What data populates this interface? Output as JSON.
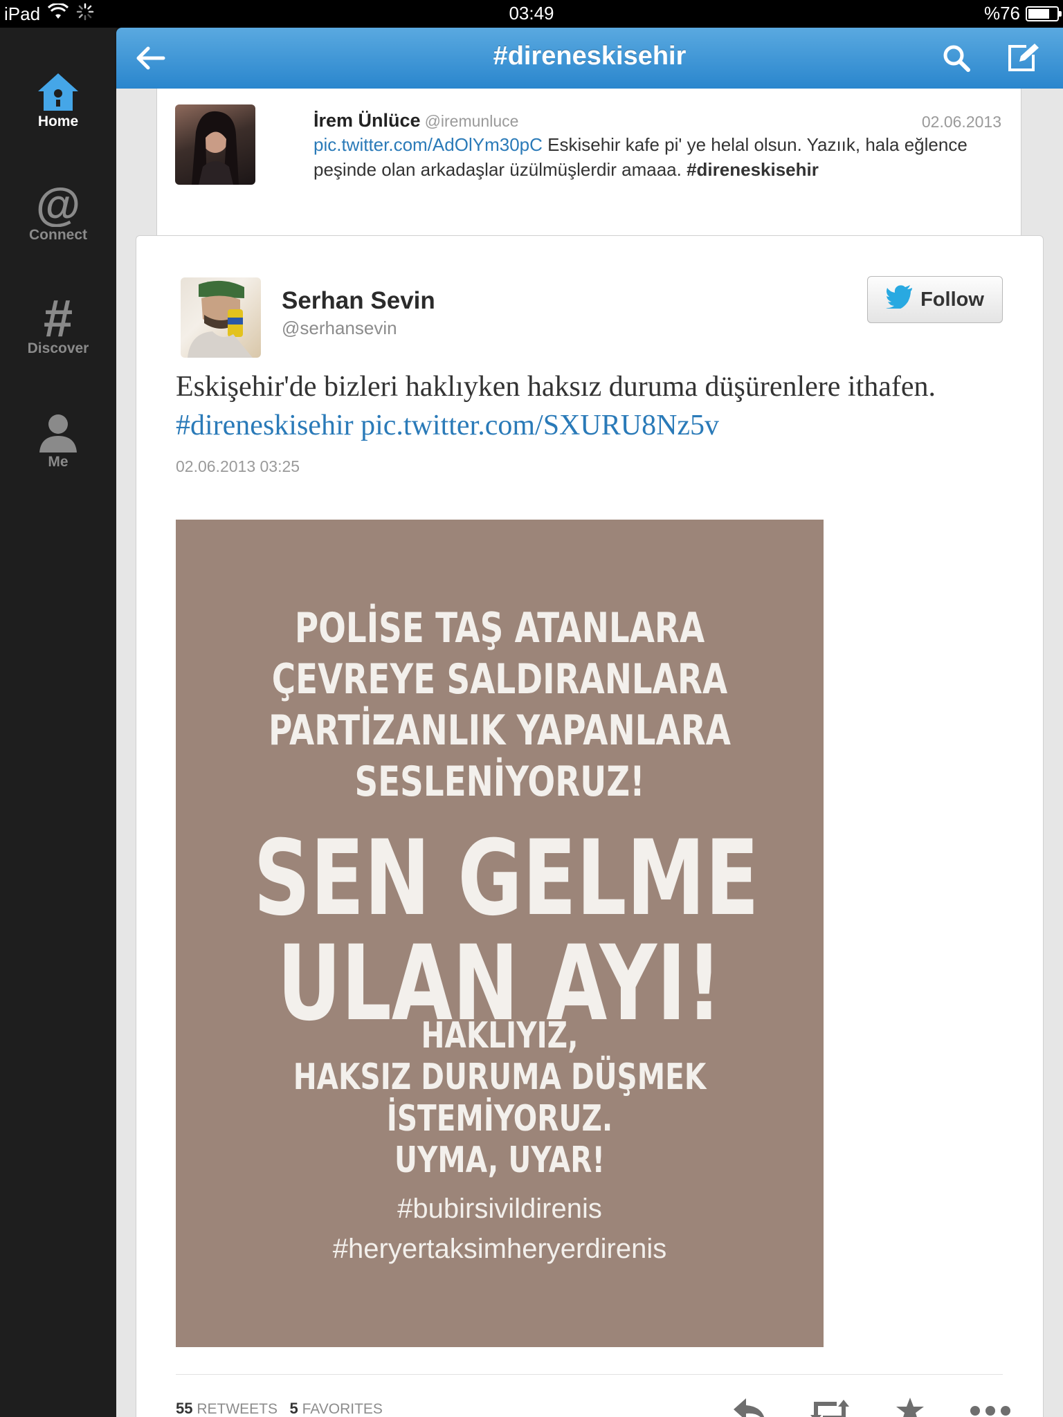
{
  "status_bar": {
    "device": "iPad",
    "time": "03:49",
    "battery": "%76",
    "battery_level": 0.76
  },
  "sidebar": {
    "items": [
      {
        "label": "Home",
        "icon": "home-icon",
        "active": true
      },
      {
        "label": "Connect",
        "icon": "at-icon",
        "active": false
      },
      {
        "label": "Discover",
        "icon": "hash-icon",
        "active": false
      },
      {
        "label": "Me",
        "icon": "person-icon",
        "active": false
      }
    ]
  },
  "header": {
    "title": "#direneskisehir",
    "back_icon": "back-arrow-icon",
    "search_icon": "search-icon",
    "compose_icon": "compose-icon",
    "accent": "#2a86cd"
  },
  "previous_tweet": {
    "name": "İrem Ünlüce",
    "handle": "@iremunluce",
    "date": "02.06.2013",
    "link": "pic.twitter.com/AdOlYm30pC",
    "text": " Eskisehir kafe pi' ye helal olsun. Yazıık, hala eğlence peşinde olan arkadaşlar üzülmüşlerdir amaaa. ",
    "hashtag": "#direneskisehir"
  },
  "tweet": {
    "name": "Serhan Sevin",
    "handle": "@serhansevin",
    "follow_label": "Follow",
    "text": "Eskişehir'de bizleri haklıyken haksız duruma düşürenlere ithafen. ",
    "hashtag": "#direneskisehir",
    "link": "pic.twitter.com/SXURU8Nz5v",
    "timestamp": "02.06.2013 03:25",
    "media_lines": {
      "l1": "POLİSE TAŞ ATANLARA",
      "l2": "ÇEVREYE SALDIRANLARA",
      "l3": "PARTİZANLIK YAPANLARA",
      "l4": "SESLENİYORUZ!",
      "l5": "SEN GELME",
      "l6": "ULAN AYI!",
      "l7": "HAKLIYIZ,",
      "l8": "HAKSIZ DURUMA DÜŞMEK",
      "l9": "İSTEMİYORUZ.",
      "l10": "UYMA, UYAR!",
      "l11": "#bubirsivildirenis",
      "l12": "#heryertaksimheryerdirenis"
    },
    "media_bg": "#9c8579",
    "retweets": "55",
    "retweets_label": "RETWEETS",
    "favorites": "5",
    "favorites_label": "FAVORITES",
    "actions": [
      "reply-icon",
      "retweet-icon",
      "favorite-icon",
      "more-icon"
    ]
  }
}
